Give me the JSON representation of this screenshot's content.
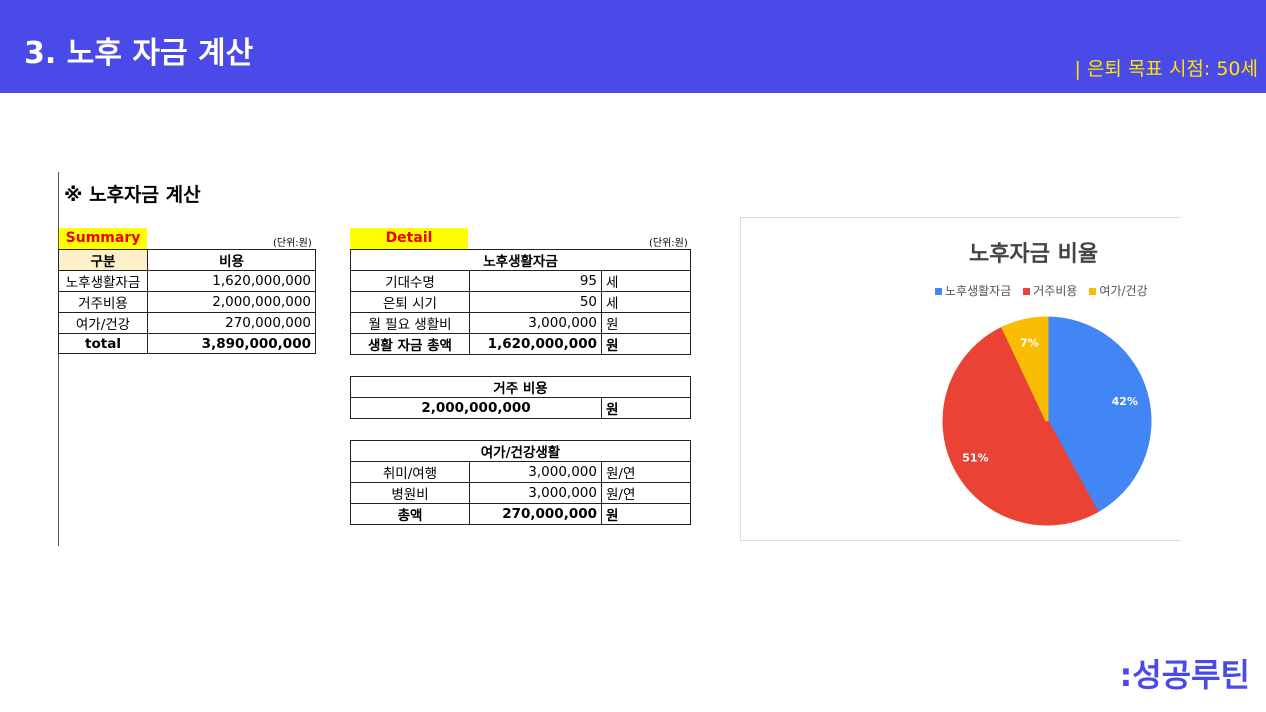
{
  "header": {
    "title": "3. 노후 자금 계산",
    "subtitle": "| 은퇴 목표 시점: 50세"
  },
  "section_title": "※ 노후자금 계산",
  "summary": {
    "tag": "Summary",
    "unit": "(단위:원)",
    "headers": [
      "구분",
      "비용"
    ],
    "rows": [
      [
        "노후생활자금",
        "1,620,000,000"
      ],
      [
        "거주비용",
        "2,000,000,000"
      ],
      [
        "여가/건강",
        "270,000,000"
      ]
    ],
    "total": [
      "total",
      "3,890,000,000"
    ]
  },
  "detail": {
    "tag": "Detail",
    "unit": "(단위:원)",
    "living": {
      "title": "노후생활자금",
      "rows": [
        [
          "기대수명",
          "95",
          "세"
        ],
        [
          "은퇴 시기",
          "50",
          "세"
        ],
        [
          "월 필요 생활비",
          "3,000,000",
          "원"
        ],
        [
          "생활 자금 총액",
          "1,620,000,000",
          "원"
        ]
      ]
    },
    "housing": {
      "title": "거주 비용",
      "value": "2,000,000,000",
      "unit": "원"
    },
    "leisure": {
      "title": "여가/건강생활",
      "rows": [
        [
          "취미/여행",
          "3,000,000",
          "원/연"
        ],
        [
          "병원비",
          "3,000,000",
          "원/연"
        ],
        [
          "총액",
          "270,000,000",
          "원"
        ]
      ]
    }
  },
  "chart_data": {
    "type": "pie",
    "title": "노후자금 비율",
    "categories": [
      "노후생활자금",
      "거주비용",
      "여가/건강"
    ],
    "values": [
      42,
      51,
      7
    ],
    "labels": [
      "42%",
      "51%",
      "7%"
    ],
    "colors": [
      "#4285f4",
      "#ea4335",
      "#fbbc04"
    ],
    "legend": "top"
  },
  "logo": ":성공루틴"
}
